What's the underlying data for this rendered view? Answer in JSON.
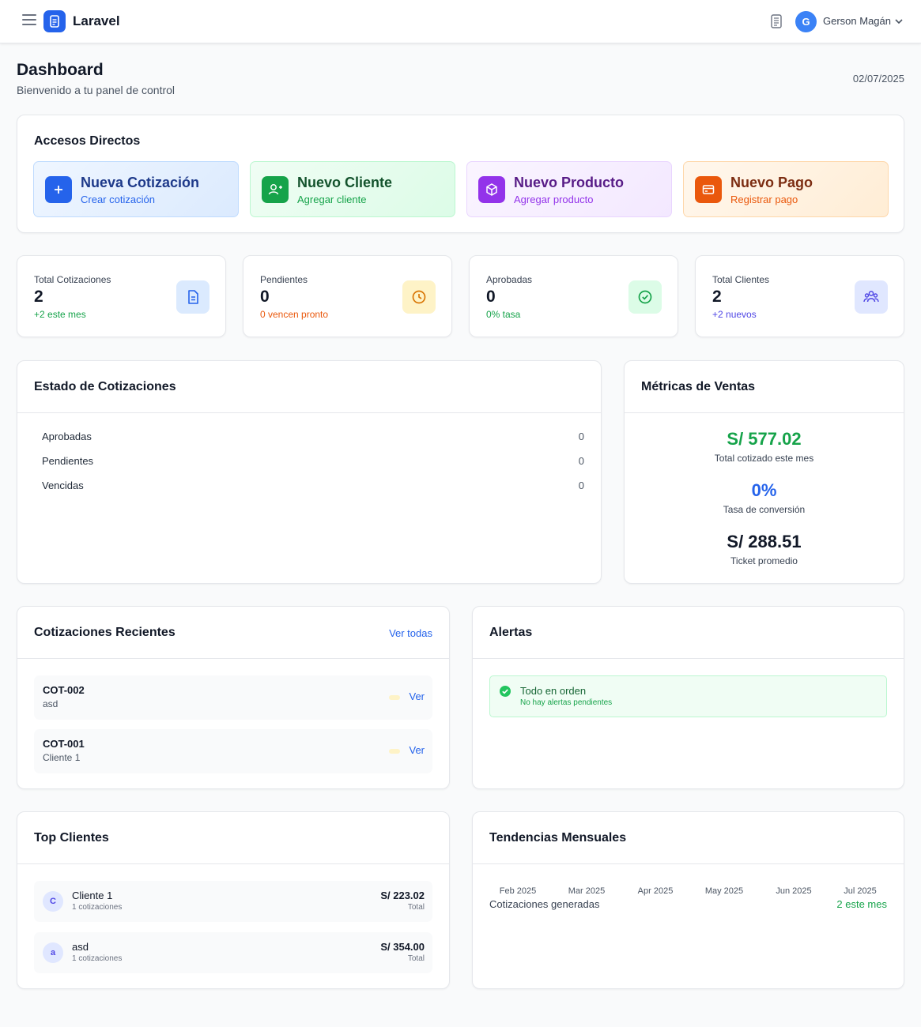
{
  "topbar": {
    "app_name": "Laravel",
    "user_initial": "G",
    "user_name": "Gerson Magán"
  },
  "header": {
    "title": "Dashboard",
    "subtitle": "Bienvenido a tu panel de control",
    "date": "02/07/2025"
  },
  "accesos": {
    "title": "Accesos Directos",
    "items": [
      {
        "title": "Nueva Cotización",
        "sub": "Crear cotización",
        "icon": "plus-icon",
        "color": "#2563eb"
      },
      {
        "title": "Nuevo Cliente",
        "sub": "Agregar cliente",
        "icon": "user-plus-icon",
        "color": "#16a34a"
      },
      {
        "title": "Nuevo Producto",
        "sub": "Agregar producto",
        "icon": "box-icon",
        "color": "#9333ea"
      },
      {
        "title": "Nuevo Pago",
        "sub": "Registrar pago",
        "icon": "credit-card-icon",
        "color": "#ea580c"
      }
    ]
  },
  "stats": [
    {
      "label": "Total Cotizaciones",
      "value": "2",
      "note": "+2 este mes",
      "icon": "document-icon",
      "color": "#16a34a"
    },
    {
      "label": "Pendientes",
      "value": "0",
      "note": "0 vencen pronto",
      "icon": "clock-icon",
      "color": "#ea580c"
    },
    {
      "label": "Aprobadas",
      "value": "0",
      "note": "0% tasa",
      "icon": "check-circle-icon",
      "color": "#16a34a"
    },
    {
      "label": "Total Clientes",
      "value": "2",
      "note": "+2 nuevos",
      "icon": "users-icon",
      "color": "#4f46e5"
    }
  ],
  "estado": {
    "title": "Estado de Cotizaciones",
    "rows": [
      {
        "label": "Aprobadas",
        "count": "0"
      },
      {
        "label": "Pendientes",
        "count": "0"
      },
      {
        "label": "Vencidas",
        "count": "0"
      }
    ]
  },
  "metricas": {
    "title": "Métricas de Ventas",
    "items": [
      {
        "value": "S/ 577.02",
        "label": "Total cotizado este mes",
        "color": "#16a34a"
      },
      {
        "value": "0%",
        "label": "Tasa de conversión",
        "color": "#2563eb"
      },
      {
        "value": "S/ 288.51",
        "label": "Ticket promedio",
        "color": "#111827"
      }
    ]
  },
  "recientes": {
    "title": "Cotizaciones Recientes",
    "link": "Ver todas",
    "items": [
      {
        "code": "COT-002",
        "client": "asd",
        "action": "Ver"
      },
      {
        "code": "COT-001",
        "client": "Cliente 1",
        "action": "Ver"
      }
    ]
  },
  "alertas": {
    "title": "Alertas",
    "alert_title": "Todo en orden",
    "alert_sub": "No hay alertas pendientes"
  },
  "top_clientes": {
    "title": "Top Clientes",
    "items": [
      {
        "initial": "C",
        "name": "Cliente 1",
        "count": "1 cotizaciones",
        "total": "S/ 223.02",
        "total_label": "Total"
      },
      {
        "initial": "a",
        "name": "asd",
        "count": "1 cotizaciones",
        "total": "S/ 354.00",
        "total_label": "Total"
      }
    ]
  },
  "tendencias": {
    "title": "Tendencias Mensuales",
    "months": [
      "Feb 2025",
      "Mar 2025",
      "Apr 2025",
      "May 2025",
      "Jun 2025",
      "Jul 2025"
    ],
    "label": "Cotizaciones generadas",
    "note": "2 este mes"
  }
}
